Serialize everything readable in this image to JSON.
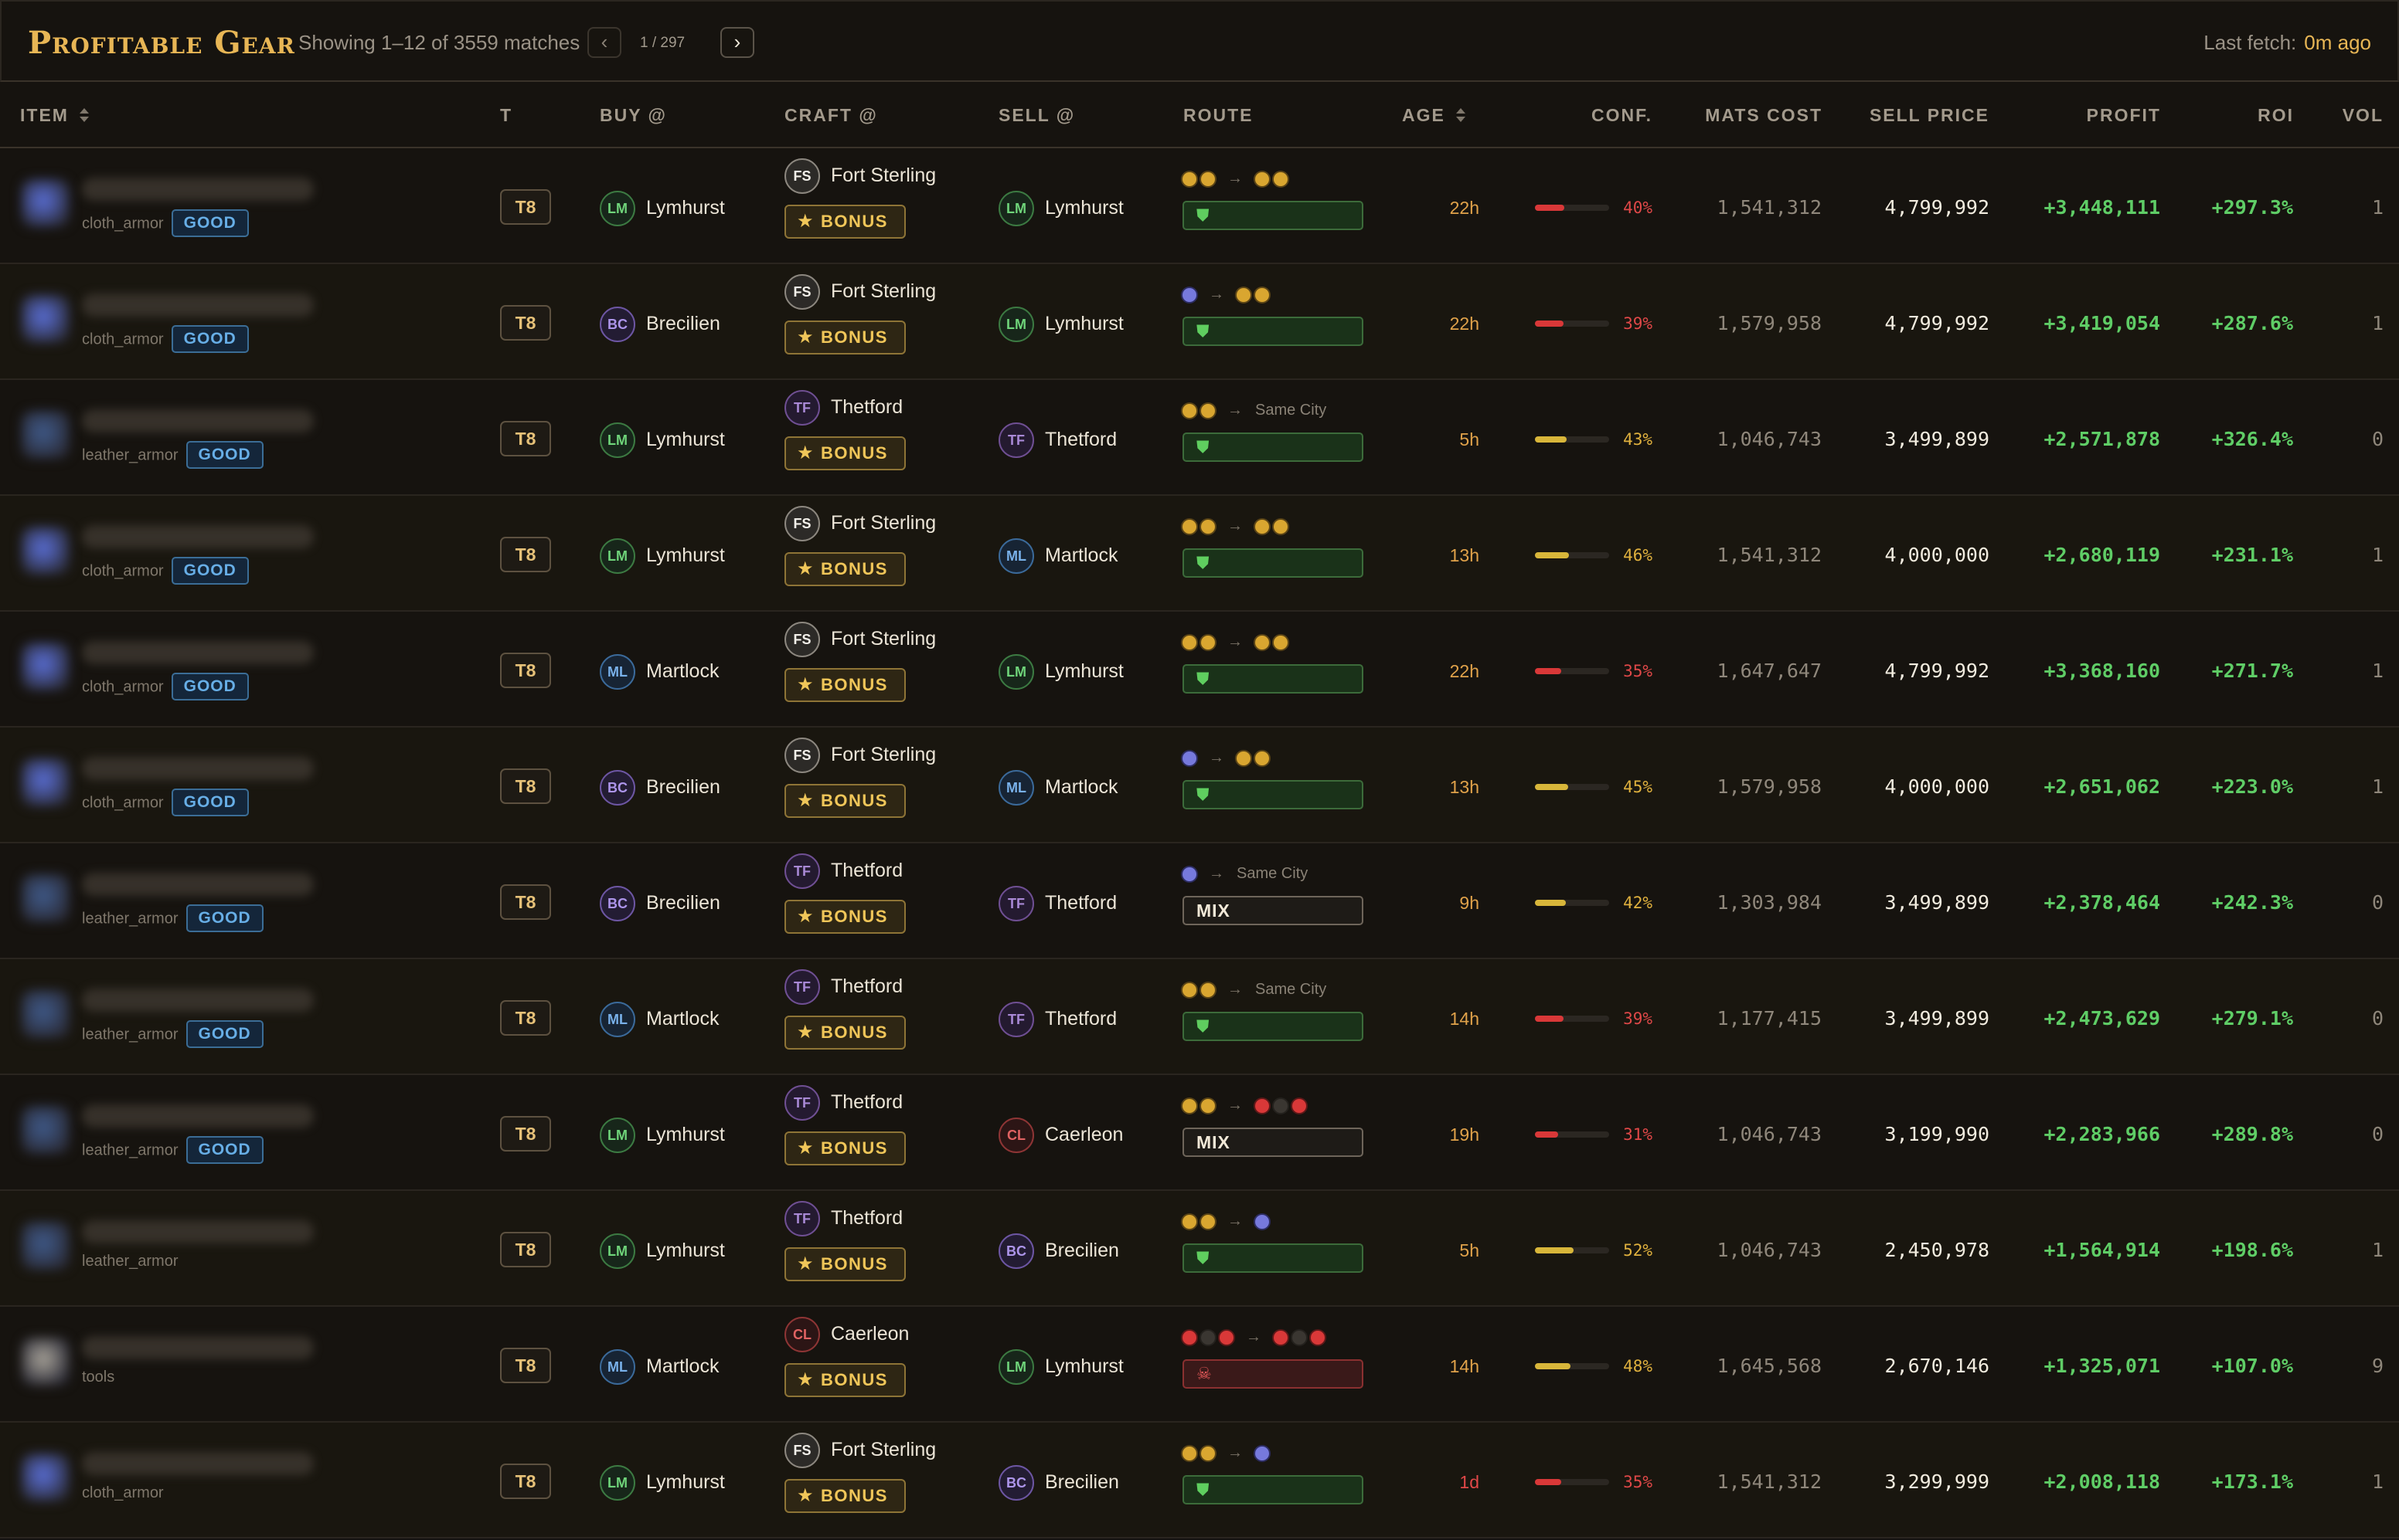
{
  "header": {
    "title": "Profitable Gear",
    "showing": "Showing 1–12 of 3559 matches",
    "page_label": "1 / 297",
    "prev_icon": "chevron-left-icon",
    "next_icon": "chevron-right-icon",
    "last_fetch_label": "Last fetch:",
    "last_fetch_value": "0m ago"
  },
  "columns": {
    "item": "ITEM",
    "tier": "T",
    "buy": "BUY @",
    "craft": "CRAFT @",
    "sell": "SELL @",
    "route": "ROUTE",
    "age": "AGE",
    "conf": "CONF.",
    "mats": "MATS COST",
    "sell_price": "SELL PRICE",
    "profit": "PROFIT",
    "roi": "ROI",
    "vol": "VOL"
  },
  "labels": {
    "good": "GOOD",
    "bonus": "BONUS",
    "mix": "MIX",
    "same_city": "Same City"
  },
  "colors": {
    "accent": "#e8b655",
    "profit_green": "#5fcd66",
    "conf_low": "#d93838",
    "conf_mid": "#d8b63a",
    "safe_route": "#5fce5f",
    "danger_route": "#ea5a5a"
  },
  "rows": [
    {
      "cat": "cloth_armor",
      "good": true,
      "thumb": "#5a6fd8",
      "tier": "T8",
      "buy": {
        "code": "LM",
        "name": "Lymhurst"
      },
      "craft": {
        "code": "FS",
        "name": "Fort Sterling"
      },
      "sell": {
        "code": "LM",
        "name": "Lymhurst"
      },
      "from": [
        "y",
        "y"
      ],
      "to": [
        "y",
        "y"
      ],
      "same": false,
      "risk": "safe",
      "age": "22h",
      "age_red": false,
      "conf": 0.4,
      "conf_text": "40%",
      "conf_color": "red",
      "mats": "1,541,312",
      "sell_price": "4,799,992",
      "profit": "+3,448,111",
      "roi": "+297.3%",
      "vol": "1"
    },
    {
      "cat": "cloth_armor",
      "good": true,
      "thumb": "#5a6fd8",
      "tier": "T8",
      "buy": {
        "code": "BC",
        "name": "Brecilien"
      },
      "craft": {
        "code": "FS",
        "name": "Fort Sterling"
      },
      "sell": {
        "code": "LM",
        "name": "Lymhurst"
      },
      "from": [
        "b"
      ],
      "to": [
        "y",
        "y"
      ],
      "same": false,
      "risk": "safe",
      "age": "22h",
      "age_red": false,
      "conf": 0.39,
      "conf_text": "39%",
      "conf_color": "red",
      "mats": "1,579,958",
      "sell_price": "4,799,992",
      "profit": "+3,419,054",
      "roi": "+287.6%",
      "vol": "1"
    },
    {
      "cat": "leather_armor",
      "good": true,
      "thumb": "#3f5a8a",
      "tier": "T8",
      "buy": {
        "code": "LM",
        "name": "Lymhurst"
      },
      "craft": {
        "code": "TF",
        "name": "Thetford"
      },
      "sell": {
        "code": "TF",
        "name": "Thetford"
      },
      "from": [
        "y",
        "y"
      ],
      "to": [],
      "same": true,
      "risk": "safe",
      "age": "5h",
      "age_red": false,
      "conf": 0.43,
      "conf_text": "43%",
      "conf_color": "yellow",
      "mats": "1,046,743",
      "sell_price": "3,499,899",
      "profit": "+2,571,878",
      "roi": "+326.4%",
      "vol": "0"
    },
    {
      "cat": "cloth_armor",
      "good": true,
      "thumb": "#5a6fd8",
      "tier": "T8",
      "buy": {
        "code": "LM",
        "name": "Lymhurst"
      },
      "craft": {
        "code": "FS",
        "name": "Fort Sterling"
      },
      "sell": {
        "code": "ML",
        "name": "Martlock"
      },
      "from": [
        "y",
        "y"
      ],
      "to": [
        "y",
        "y"
      ],
      "same": false,
      "risk": "safe",
      "age": "13h",
      "age_red": false,
      "conf": 0.46,
      "conf_text": "46%",
      "conf_color": "yellow",
      "mats": "1,541,312",
      "sell_price": "4,000,000",
      "profit": "+2,680,119",
      "roi": "+231.1%",
      "vol": "1"
    },
    {
      "cat": "cloth_armor",
      "good": true,
      "thumb": "#5a6fd8",
      "tier": "T8",
      "buy": {
        "code": "ML",
        "name": "Martlock"
      },
      "craft": {
        "code": "FS",
        "name": "Fort Sterling"
      },
      "sell": {
        "code": "LM",
        "name": "Lymhurst"
      },
      "from": [
        "y",
        "y"
      ],
      "to": [
        "y",
        "y"
      ],
      "same": false,
      "risk": "safe",
      "age": "22h",
      "age_red": false,
      "conf": 0.35,
      "conf_text": "35%",
      "conf_color": "red",
      "mats": "1,647,647",
      "sell_price": "4,799,992",
      "profit": "+3,368,160",
      "roi": "+271.7%",
      "vol": "1"
    },
    {
      "cat": "cloth_armor",
      "good": true,
      "thumb": "#5a6fd8",
      "tier": "T8",
      "buy": {
        "code": "BC",
        "name": "Brecilien"
      },
      "craft": {
        "code": "FS",
        "name": "Fort Sterling"
      },
      "sell": {
        "code": "ML",
        "name": "Martlock"
      },
      "from": [
        "b"
      ],
      "to": [
        "y",
        "y"
      ],
      "same": false,
      "risk": "safe",
      "age": "13h",
      "age_red": false,
      "conf": 0.45,
      "conf_text": "45%",
      "conf_color": "yellow",
      "mats": "1,579,958",
      "sell_price": "4,000,000",
      "profit": "+2,651,062",
      "roi": "+223.0%",
      "vol": "1"
    },
    {
      "cat": "leather_armor",
      "good": true,
      "thumb": "#3f5a8a",
      "tier": "T8",
      "buy": {
        "code": "BC",
        "name": "Brecilien"
      },
      "craft": {
        "code": "TF",
        "name": "Thetford"
      },
      "sell": {
        "code": "TF",
        "name": "Thetford"
      },
      "from": [
        "b"
      ],
      "to": [],
      "same": true,
      "risk": "mix",
      "age": "9h",
      "age_red": false,
      "conf": 0.42,
      "conf_text": "42%",
      "conf_color": "yellow",
      "mats": "1,303,984",
      "sell_price": "3,499,899",
      "profit": "+2,378,464",
      "roi": "+242.3%",
      "vol": "0"
    },
    {
      "cat": "leather_armor",
      "good": true,
      "thumb": "#3f5a8a",
      "tier": "T8",
      "buy": {
        "code": "ML",
        "name": "Martlock"
      },
      "craft": {
        "code": "TF",
        "name": "Thetford"
      },
      "sell": {
        "code": "TF",
        "name": "Thetford"
      },
      "from": [
        "y",
        "y"
      ],
      "to": [],
      "same": true,
      "risk": "safe",
      "age": "14h",
      "age_red": false,
      "conf": 0.39,
      "conf_text": "39%",
      "conf_color": "red",
      "mats": "1,177,415",
      "sell_price": "3,499,899",
      "profit": "+2,473,629",
      "roi": "+279.1%",
      "vol": "0"
    },
    {
      "cat": "leather_armor",
      "good": true,
      "thumb": "#3f5a8a",
      "tier": "T8",
      "buy": {
        "code": "LM",
        "name": "Lymhurst"
      },
      "craft": {
        "code": "TF",
        "name": "Thetford"
      },
      "sell": {
        "code": "CL",
        "name": "Caerleon"
      },
      "from": [
        "y",
        "y"
      ],
      "to": [
        "r",
        "k",
        "r"
      ],
      "same": false,
      "risk": "mix",
      "age": "19h",
      "age_red": false,
      "conf": 0.31,
      "conf_text": "31%",
      "conf_color": "red",
      "mats": "1,046,743",
      "sell_price": "3,199,990",
      "profit": "+2,283,966",
      "roi": "+289.8%",
      "vol": "0"
    },
    {
      "cat": "leather_armor",
      "good": false,
      "thumb": "#3f5a8a",
      "tier": "T8",
      "buy": {
        "code": "LM",
        "name": "Lymhurst"
      },
      "craft": {
        "code": "TF",
        "name": "Thetford"
      },
      "sell": {
        "code": "BC",
        "name": "Brecilien"
      },
      "from": [
        "y",
        "y"
      ],
      "to": [
        "b"
      ],
      "same": false,
      "risk": "safe",
      "age": "5h",
      "age_red": false,
      "conf": 0.52,
      "conf_text": "52%",
      "conf_color": "yellow",
      "mats": "1,046,743",
      "sell_price": "2,450,978",
      "profit": "+1,564,914",
      "roi": "+198.6%",
      "vol": "1"
    },
    {
      "cat": "tools",
      "good": false,
      "thumb": "#a9a49a",
      "tier": "T8",
      "buy": {
        "code": "ML",
        "name": "Martlock"
      },
      "craft": {
        "code": "CL",
        "name": "Caerleon"
      },
      "sell": {
        "code": "LM",
        "name": "Lymhurst"
      },
      "from": [
        "r",
        "k",
        "r"
      ],
      "to": [
        "r",
        "k",
        "r"
      ],
      "same": false,
      "risk": "danger",
      "age": "14h",
      "age_red": false,
      "conf": 0.48,
      "conf_text": "48%",
      "conf_color": "yellow",
      "mats": "1,645,568",
      "sell_price": "2,670,146",
      "profit": "+1,325,071",
      "roi": "+107.0%",
      "vol": "9"
    },
    {
      "cat": "cloth_armor",
      "good": false,
      "thumb": "#5a6fd8",
      "tier": "T8",
      "buy": {
        "code": "LM",
        "name": "Lymhurst"
      },
      "craft": {
        "code": "FS",
        "name": "Fort Sterling"
      },
      "sell": {
        "code": "BC",
        "name": "Brecilien"
      },
      "from": [
        "y",
        "y"
      ],
      "to": [
        "b"
      ],
      "same": false,
      "risk": "safe",
      "age": "1d",
      "age_red": true,
      "conf": 0.35,
      "conf_text": "35%",
      "conf_color": "red",
      "mats": "1,541,312",
      "sell_price": "3,299,999",
      "profit": "+2,008,118",
      "roi": "+173.1%",
      "vol": "1"
    }
  ]
}
